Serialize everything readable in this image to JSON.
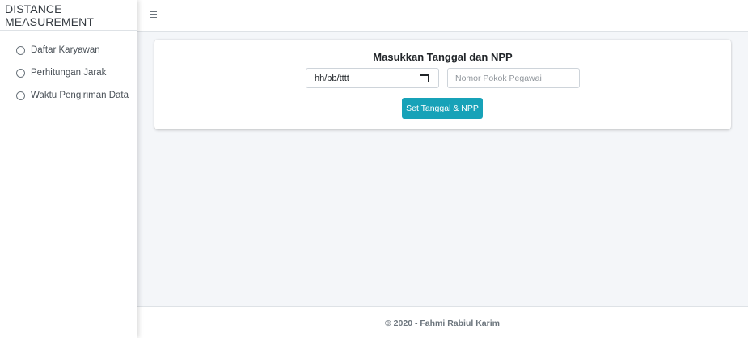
{
  "sidebar": {
    "brand": "DISTANCE MEASUREMENT",
    "items": [
      {
        "label": "Daftar Karyawan",
        "icon": "circle-icon"
      },
      {
        "label": "Perhitungan Jarak",
        "icon": "circle-icon"
      },
      {
        "label": "Waktu Pengiriman Data",
        "icon": "circle-icon"
      }
    ]
  },
  "topbar": {
    "menu_icon": "hamburger-icon"
  },
  "form": {
    "title": "Masukkan Tanggal dan NPP",
    "date_placeholder": "hh/bb/tttt",
    "npp_placeholder": "Nomor Pokok Pegawai",
    "submit_label": "Set Tanggal & NPP"
  },
  "footer": {
    "text": "© 2020 - Fahmi Rabiul Karim"
  },
  "colors": {
    "accent": "#17a2b8",
    "background": "#f4f6f9",
    "panel": "#ffffff"
  }
}
